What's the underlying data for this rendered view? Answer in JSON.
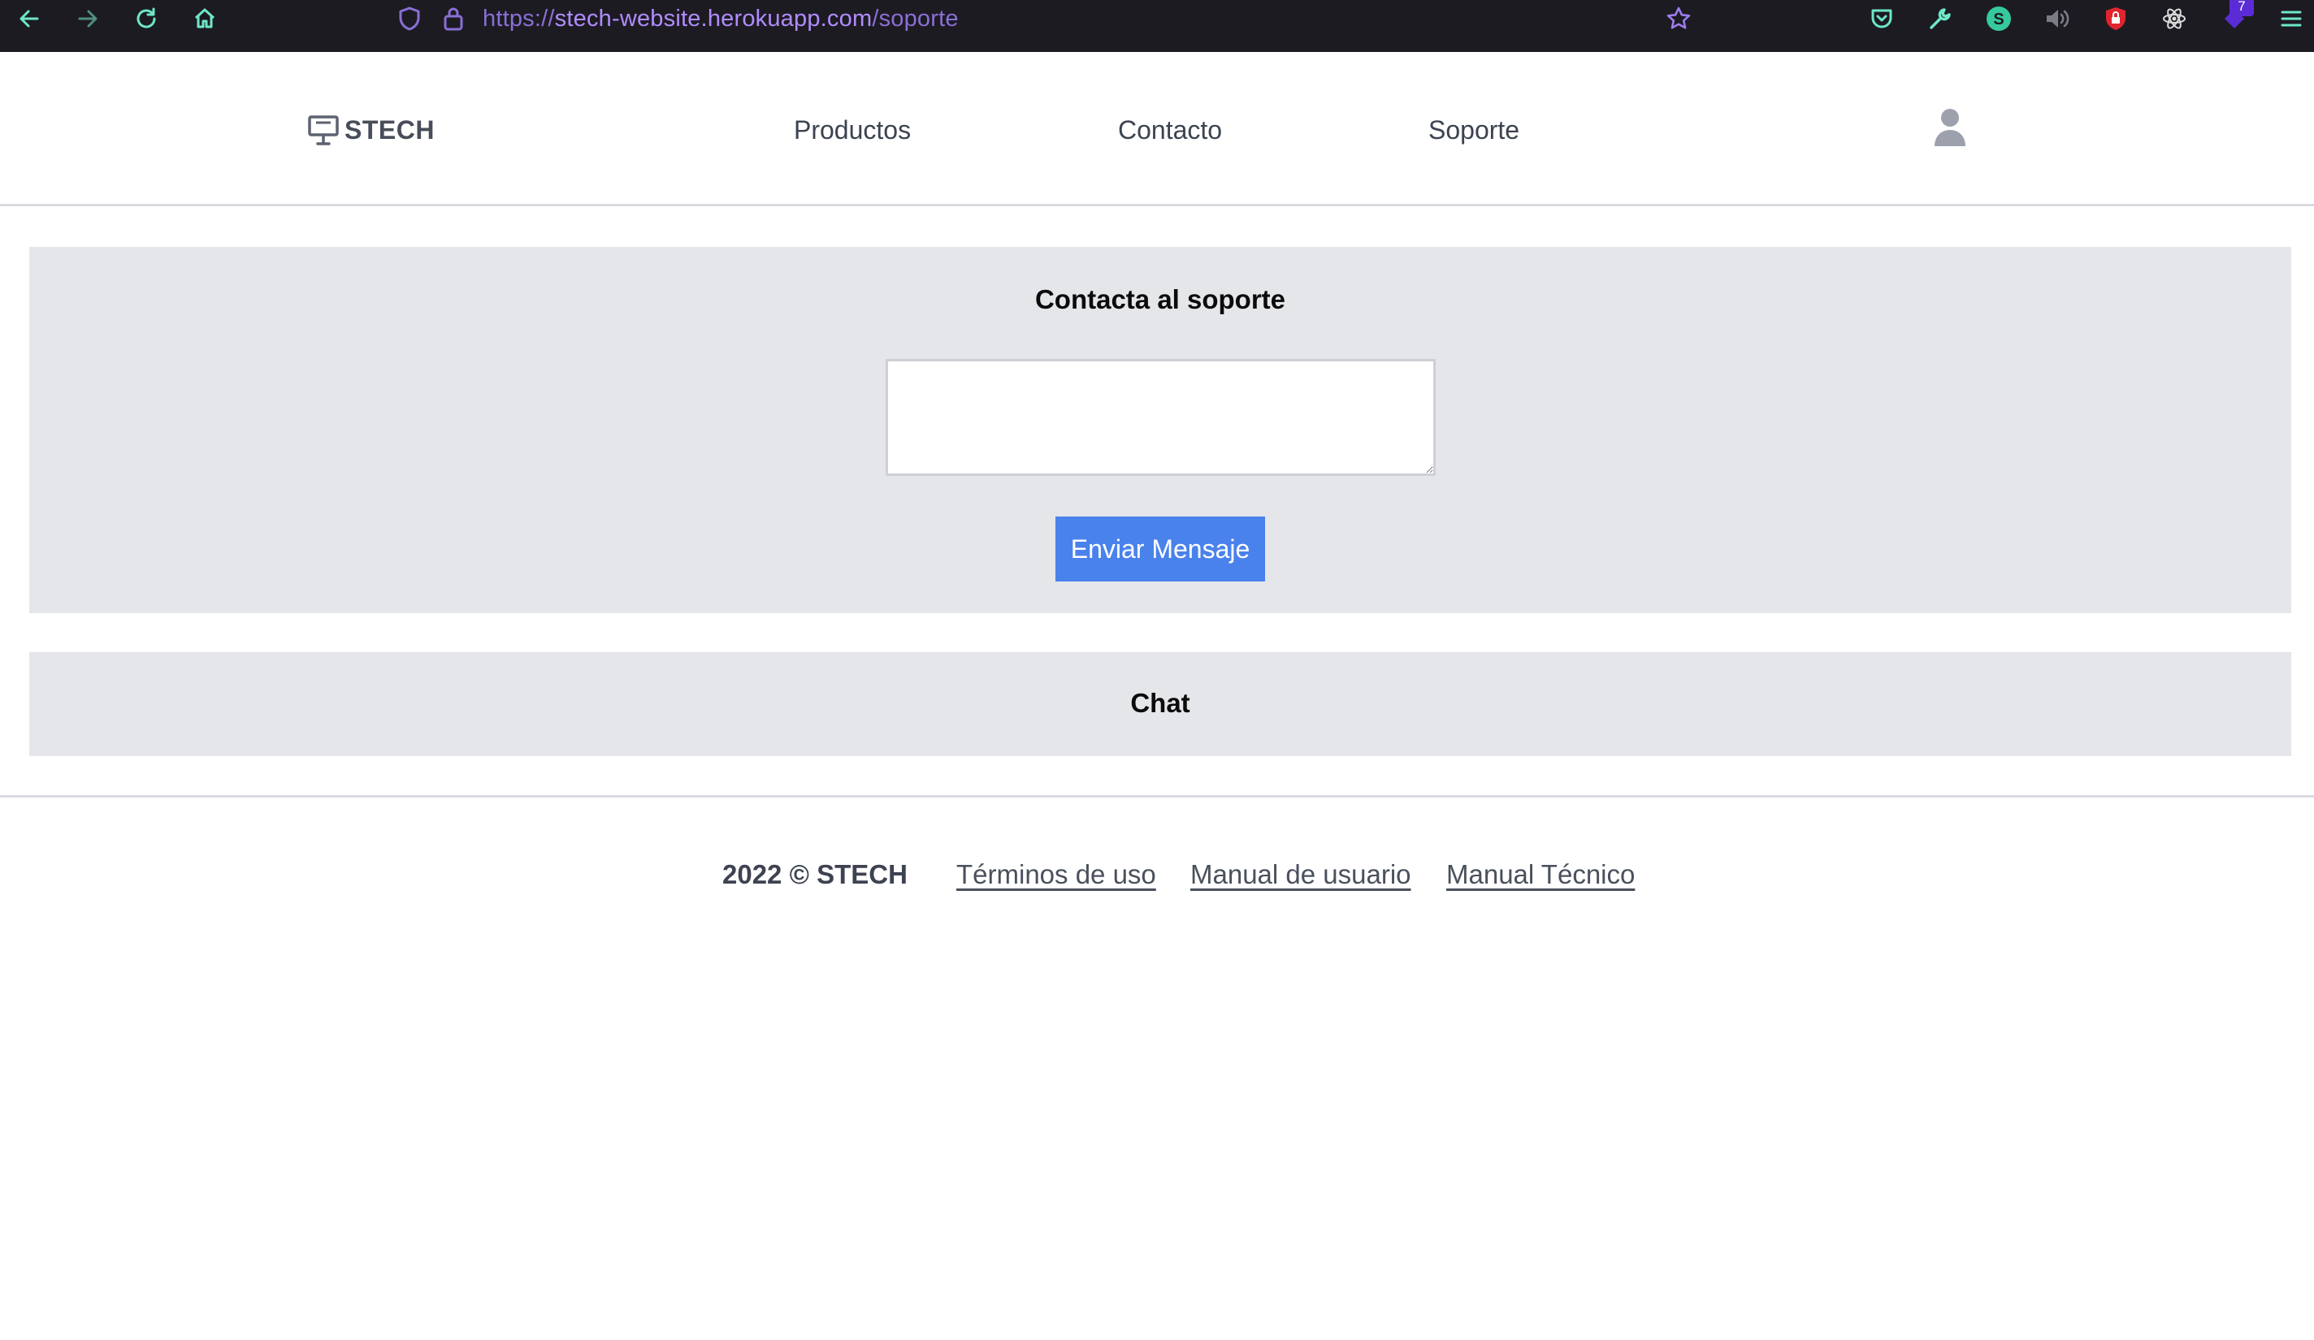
{
  "browser": {
    "url_protocol": "https://",
    "url_host": "stech-website.herokuapp.com",
    "url_path": "/soporte",
    "extensions_badge": "7",
    "icons": [
      "back-icon",
      "forward-icon",
      "reload-icon",
      "home-icon",
      "shield-icon",
      "lock-icon",
      "star-icon",
      "pocket-icon",
      "wrench-icon",
      "s-extension-icon",
      "speaker-icon",
      "shield-lock-icon",
      "react-icon",
      "extension-badge-icon",
      "menu-icon"
    ]
  },
  "header": {
    "logo_text": "STECH",
    "nav": {
      "products": "Productos",
      "contact": "Contacto",
      "support": "Soporte"
    }
  },
  "support": {
    "title": "Contacta al soporte",
    "message_value": "",
    "send_label": "Enviar Mensaje"
  },
  "chat": {
    "title": "Chat"
  },
  "footer": {
    "copyright": "2022 © STECH",
    "terms": "Términos de uso",
    "user_manual": "Manual de usuario",
    "tech_manual": "Manual Técnico"
  },
  "colors": {
    "browser_bg": "#1c1b22",
    "browser_icon": "#6ee7c5",
    "panel_bg": "#e5e6ea",
    "button_bg": "#4a82ec",
    "text_dark": "#3c4250"
  }
}
